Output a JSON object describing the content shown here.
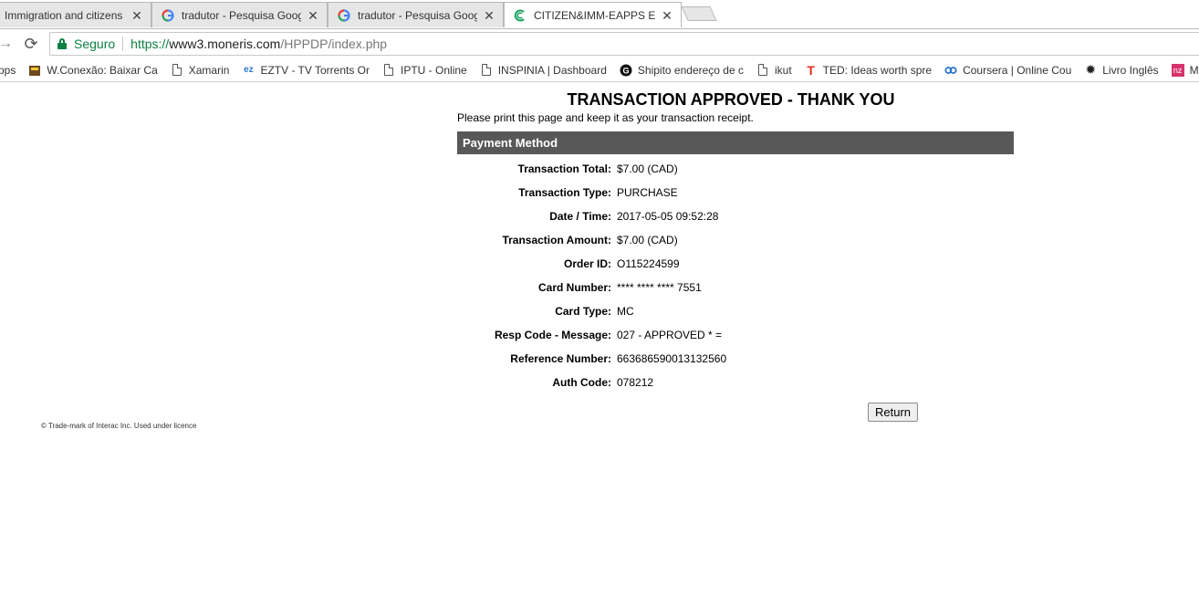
{
  "tabs": [
    {
      "title": "Immigration and citizens",
      "icon": "page"
    },
    {
      "title": "tradutor - Pesquisa Goog",
      "icon": "google"
    },
    {
      "title": "tradutor - Pesquisa Goog",
      "icon": "google"
    },
    {
      "title": "CITIZEN&IMM-EAPPS EN",
      "icon": "moneris",
      "active": true
    }
  ],
  "toolbar": {
    "secure_label": "Seguro",
    "url_scheme": "https://",
    "url_host": "www3.moneris.com",
    "url_path": "/HPPDP/index.php"
  },
  "bookmarks": [
    {
      "label": "pps",
      "icon": "apps"
    },
    {
      "label": "W.Conexão: Baixar Ca",
      "icon": "wconexao"
    },
    {
      "label": "Xamarin",
      "icon": "page"
    },
    {
      "label": "EZTV - TV Torrents Or",
      "icon": "eztv"
    },
    {
      "label": "IPTU - Online",
      "icon": "page"
    },
    {
      "label": "INSPINIA | Dashboard",
      "icon": "page"
    },
    {
      "label": "Shipito endereço de c",
      "icon": "shipito"
    },
    {
      "label": "ikut",
      "icon": "page"
    },
    {
      "label": "TED: Ideas worth spre",
      "icon": "ted"
    },
    {
      "label": "Coursera | Online Cou",
      "icon": "coursera"
    },
    {
      "label": "Livro Inglês",
      "icon": "gear"
    },
    {
      "label": "My Ca",
      "icon": "nz"
    }
  ],
  "receipt": {
    "title": "TRANSACTION APPROVED - THANK YOU",
    "note": "Please print this page and keep it as your transaction receipt.",
    "section": "Payment Method",
    "rows": [
      {
        "label": "Transaction Total:",
        "value": "$7.00 (CAD)"
      },
      {
        "label": "Transaction Type:",
        "value": "PURCHASE"
      },
      {
        "label": "Date / Time:",
        "value": "2017-05-05 09:52:28"
      },
      {
        "label": "Transaction Amount:",
        "value": "$7.00 (CAD)"
      },
      {
        "label": "Order ID:",
        "value": "O115224599"
      },
      {
        "label": "Card Number:",
        "value": "**** **** **** 7551"
      },
      {
        "label": "Card Type:",
        "value": "MC"
      },
      {
        "label": "Resp Code - Message:",
        "value": "027 - APPROVED * ="
      },
      {
        "label": "Reference Number:",
        "value": "663686590013132560"
      },
      {
        "label": "Auth Code:",
        "value": "078212"
      }
    ],
    "return_label": "Return",
    "footer": "© Trade-mark of Interac Inc. Used under licence"
  }
}
